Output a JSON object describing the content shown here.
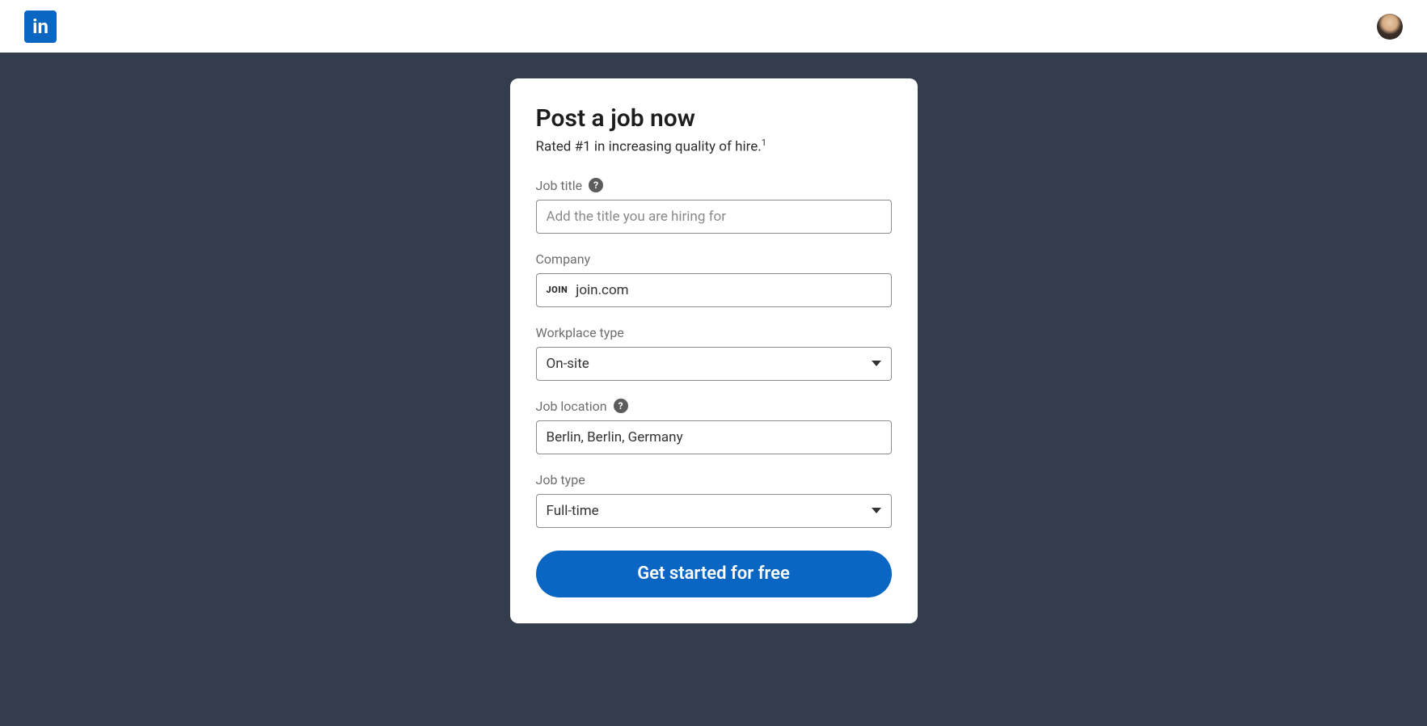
{
  "header": {
    "logo_text": "in"
  },
  "card": {
    "title": "Post a job now",
    "subtitle": "Rated #1 in increasing quality of hire.",
    "subtitle_sup": "1"
  },
  "form": {
    "job_title": {
      "label": "Job title",
      "placeholder": "Add the title you are hiring for",
      "value": ""
    },
    "company": {
      "label": "Company",
      "logo_text": "JOIN",
      "value": "join.com"
    },
    "workplace_type": {
      "label": "Workplace type",
      "value": "On-site"
    },
    "job_location": {
      "label": "Job location",
      "value": "Berlin, Berlin, Germany"
    },
    "job_type": {
      "label": "Job type",
      "value": "Full-time"
    },
    "cta": "Get started for free"
  }
}
